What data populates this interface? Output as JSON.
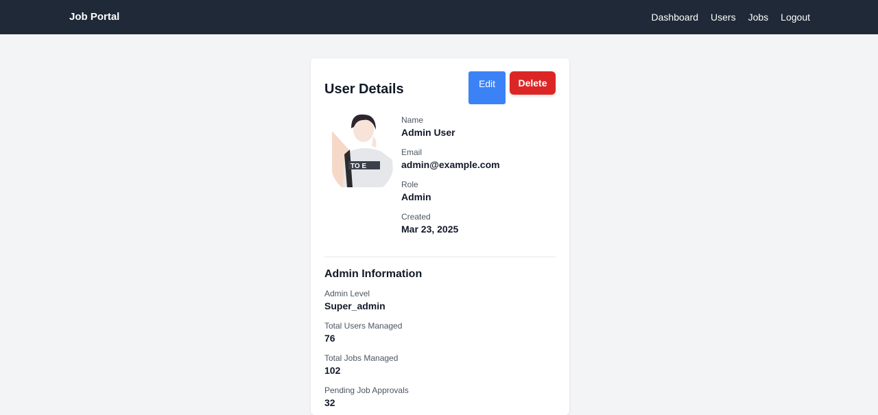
{
  "nav": {
    "brand": "Job Portal",
    "links": [
      "Dashboard",
      "Users",
      "Jobs",
      "Logout"
    ]
  },
  "card": {
    "title": "User Details",
    "edit_label": "Edit",
    "delete_label": "Delete",
    "fields": [
      {
        "label": "Name",
        "value": "Admin User"
      },
      {
        "label": "Email",
        "value": "admin@example.com"
      },
      {
        "label": "Role",
        "value": "Admin"
      },
      {
        "label": "Created",
        "value": "Mar 23, 2025"
      }
    ],
    "admin_section_title": "Admin Information",
    "admin_fields": [
      {
        "label": "Admin Level",
        "value": "Super_admin"
      },
      {
        "label": "Total Users Managed",
        "value": "76"
      },
      {
        "label": "Total Jobs Managed",
        "value": "102"
      },
      {
        "label": "Pending Job Approvals",
        "value": "32"
      }
    ]
  },
  "colors": {
    "navbar": "#1f2937",
    "background": "#f3f4f6",
    "edit_button": "#3b82f6",
    "delete_button": "#dc2626"
  }
}
